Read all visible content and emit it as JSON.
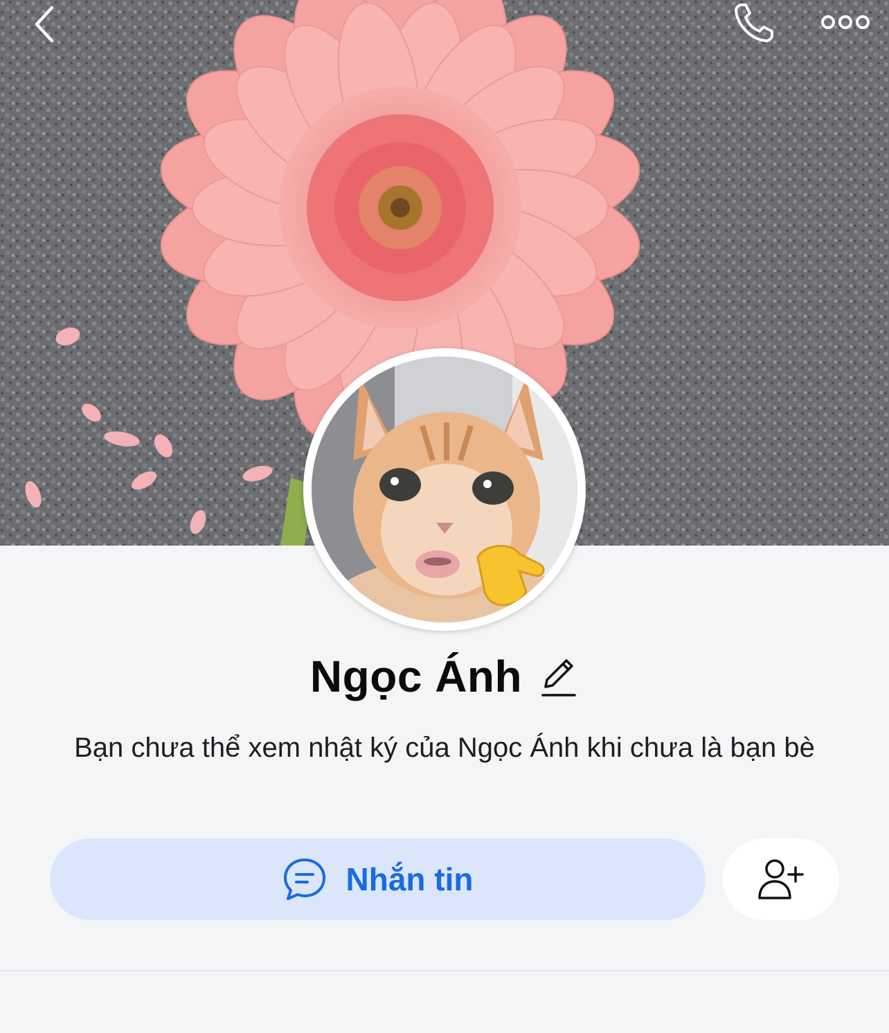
{
  "profile": {
    "name": "Ngọc Ánh",
    "info_text": "Bạn chưa thể xem nhật ký của Ngọc Ánh khi chưa là bạn bè"
  },
  "actions": {
    "message_label": "Nhắn tin"
  },
  "icons": {
    "back": "chevron-left-icon",
    "call": "phone-icon",
    "more": "more-dots-icon",
    "edit": "pencil-icon",
    "message": "chat-bubble-icon",
    "add_friend": "add-user-icon"
  },
  "colors": {
    "accent": "#1a6be0",
    "message_button_bg": "#dbe6fb",
    "page_bg": "#f4f5f7",
    "cover_flower": "#f4a6a4"
  }
}
